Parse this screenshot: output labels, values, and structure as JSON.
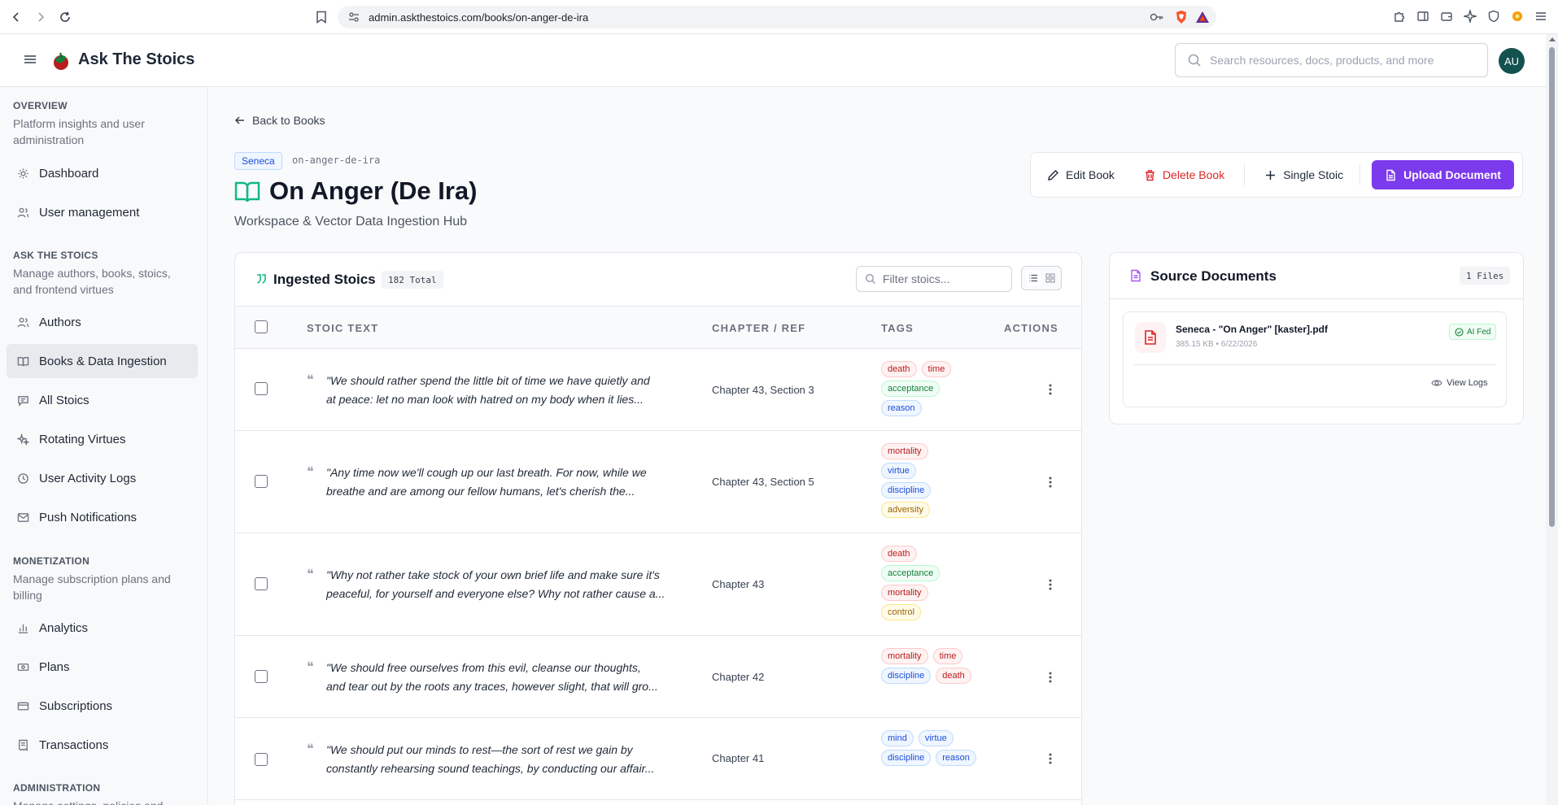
{
  "browser": {
    "url": "admin.askthestoics.com/books/on-anger-de-ira"
  },
  "header": {
    "app_name": "Ask The Stoics",
    "search_placeholder": "Search resources, docs, products, and more",
    "avatar_initials": "AU"
  },
  "sidebar": {
    "sections": [
      {
        "title": "OVERVIEW",
        "description": "Platform insights and user administration"
      },
      {
        "title": "ASK THE STOICS",
        "description": "Manage authors, books, stoics, and frontend virtues"
      },
      {
        "title": "MONETIZATION",
        "description": "Manage subscription plans and billing"
      },
      {
        "title": "ADMINISTRATION",
        "description": "Manage settings, policies and"
      }
    ],
    "items": [
      {
        "label": "Dashboard",
        "icon": "gear-icon"
      },
      {
        "label": "User management",
        "icon": "users-icon"
      },
      {
        "label": "Authors",
        "icon": "users-icon"
      },
      {
        "label": "Books & Data Ingestion",
        "icon": "book-icon",
        "active": true
      },
      {
        "label": "All Stoics",
        "icon": "message-icon"
      },
      {
        "label": "Rotating Virtues",
        "icon": "sparkle-icon"
      },
      {
        "label": "User Activity Logs",
        "icon": "history-icon"
      },
      {
        "label": "Push Notifications",
        "icon": "mail-icon"
      },
      {
        "label": "Analytics",
        "icon": "bar-chart-icon"
      },
      {
        "label": "Plans",
        "icon": "banknote-icon"
      },
      {
        "label": "Subscriptions",
        "icon": "wallet-icon"
      },
      {
        "label": "Transactions",
        "icon": "receipt-icon"
      }
    ]
  },
  "page": {
    "back_label": "Back to Books",
    "author_badge": "Seneca",
    "slug": "on-anger-de-ira",
    "title": "On Anger (De Ira)",
    "subtitle": "Workspace & Vector Data Ingestion Hub",
    "actions": {
      "edit": "Edit Book",
      "delete": "Delete Book",
      "single": "Single Stoic",
      "upload": "Upload Document"
    }
  },
  "stoics": {
    "title": "Ingested Stoics",
    "total_badge": "182 Total",
    "filter_placeholder": "Filter stoics...",
    "columns": {
      "text": "STOIC TEXT",
      "chapter": "CHAPTER / REF",
      "tags": "TAGS",
      "actions": "ACTIONS"
    },
    "rows": [
      {
        "line1": "\"We should rather spend the little bit of time we have quietly and",
        "line2": "at peace: let no man look with hatred on my body when it lies...",
        "chapter": "Chapter 43, Section 3",
        "tags": [
          {
            "label": "death",
            "color": "red"
          },
          {
            "label": "time",
            "color": "red"
          },
          {
            "label": "acceptance",
            "color": "green"
          },
          {
            "label": "reason",
            "color": "blue"
          }
        ]
      },
      {
        "line1": "\"Any time now we'll cough up our last breath. For now, while we",
        "line2": "breathe and are among our fellow humans, let's cherish the...",
        "chapter": "Chapter 43, Section 5",
        "tags": [
          {
            "label": "mortality",
            "color": "red"
          },
          {
            "label": "virtue",
            "color": "blue"
          },
          {
            "label": "discipline",
            "color": "blue"
          },
          {
            "label": "adversity",
            "color": "yellow"
          }
        ]
      },
      {
        "line1": "\"Why not rather take stock of your own brief life and make sure it's",
        "line2": "peaceful, for yourself and everyone else? Why not rather cause a...",
        "chapter": "Chapter 43",
        "tags": [
          {
            "label": "death",
            "color": "red"
          },
          {
            "label": "acceptance",
            "color": "green"
          },
          {
            "label": "mortality",
            "color": "red"
          },
          {
            "label": "control",
            "color": "yellow"
          }
        ]
      },
      {
        "line1": "\"We should free ourselves from this evil, cleanse our thoughts,",
        "line2": "and tear out by the roots any traces, however slight, that will gro...",
        "chapter": "Chapter 42",
        "tags": [
          {
            "label": "mortality",
            "color": "red"
          },
          {
            "label": "time",
            "color": "red"
          },
          {
            "label": "discipline",
            "color": "blue"
          },
          {
            "label": "death",
            "color": "red"
          }
        ]
      },
      {
        "line1": "\"We should put our minds to rest—the sort of rest we gain by",
        "line2": "constantly rehearsing sound teachings, by conducting our affair...",
        "chapter": "Chapter 41",
        "tags": [
          {
            "label": "mind",
            "color": "blue"
          },
          {
            "label": "virtue",
            "color": "blue"
          },
          {
            "label": "discipline",
            "color": "blue"
          },
          {
            "label": "reason",
            "color": "blue"
          }
        ]
      }
    ]
  },
  "documents": {
    "title": "Source Documents",
    "files_badge": "1 Files",
    "items": [
      {
        "name": "Seneca - \"On Anger\" [kaster].pdf",
        "meta": "385.15 KB • 6/22/2026",
        "status": "AI Fed",
        "view_logs": "View Logs"
      }
    ]
  }
}
